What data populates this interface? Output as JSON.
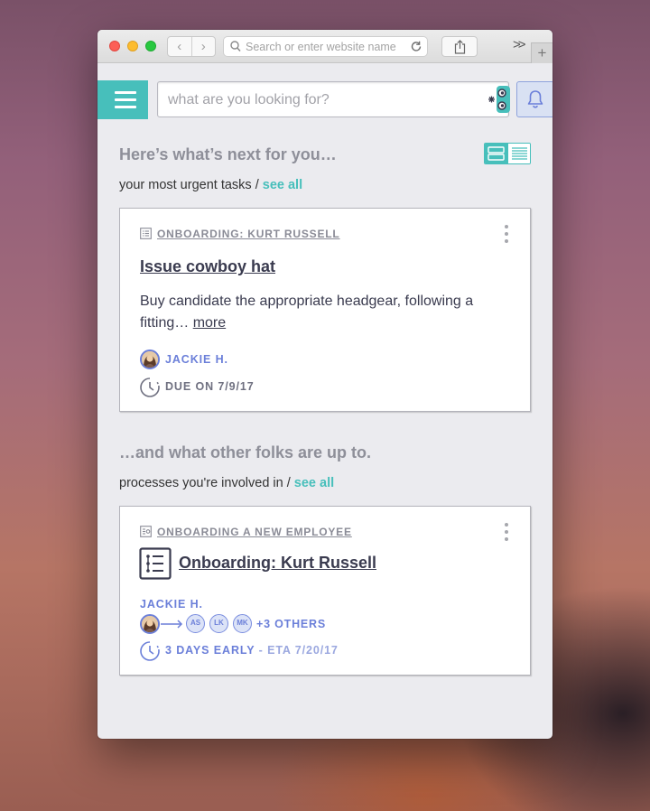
{
  "browser": {
    "url_placeholder": "Search or enter website name",
    "new_tab_label": "+",
    "overflow_label": ">>"
  },
  "app": {
    "search_placeholder": "what are you looking for?"
  },
  "next_section": {
    "heading": "Here’s what’s next for you…",
    "subheading": "your most urgent tasks /",
    "see_all": "see all"
  },
  "task_card": {
    "context": "ONBOARDING: KURT RUSSELL",
    "title": "Issue cowboy hat",
    "description": "Buy candidate the appropriate headgear, following a fitting…",
    "more_link": "more",
    "assignee": "JACKIE H.",
    "due": "DUE ON 7/9/17"
  },
  "others_section": {
    "heading": "…and what other folks are up to.",
    "subheading": "processes you're involved in /",
    "see_all": "see all"
  },
  "process_card": {
    "context": "ONBOARDING A NEW EMPLOYEE",
    "title": "Onboarding: Kurt Russell",
    "owner": "JACKIE H.",
    "participants": [
      "AS",
      "LK",
      "MK"
    ],
    "others": "+3 OTHERS",
    "status_early": "3 DAYS EARLY",
    "status_eta": "- ETA 7/20/17"
  },
  "colors": {
    "accent_teal": "#47bfbb",
    "accent_blue": "#6b7fd9",
    "text_dark": "#3a3b4f",
    "text_muted": "#8e8f99"
  }
}
